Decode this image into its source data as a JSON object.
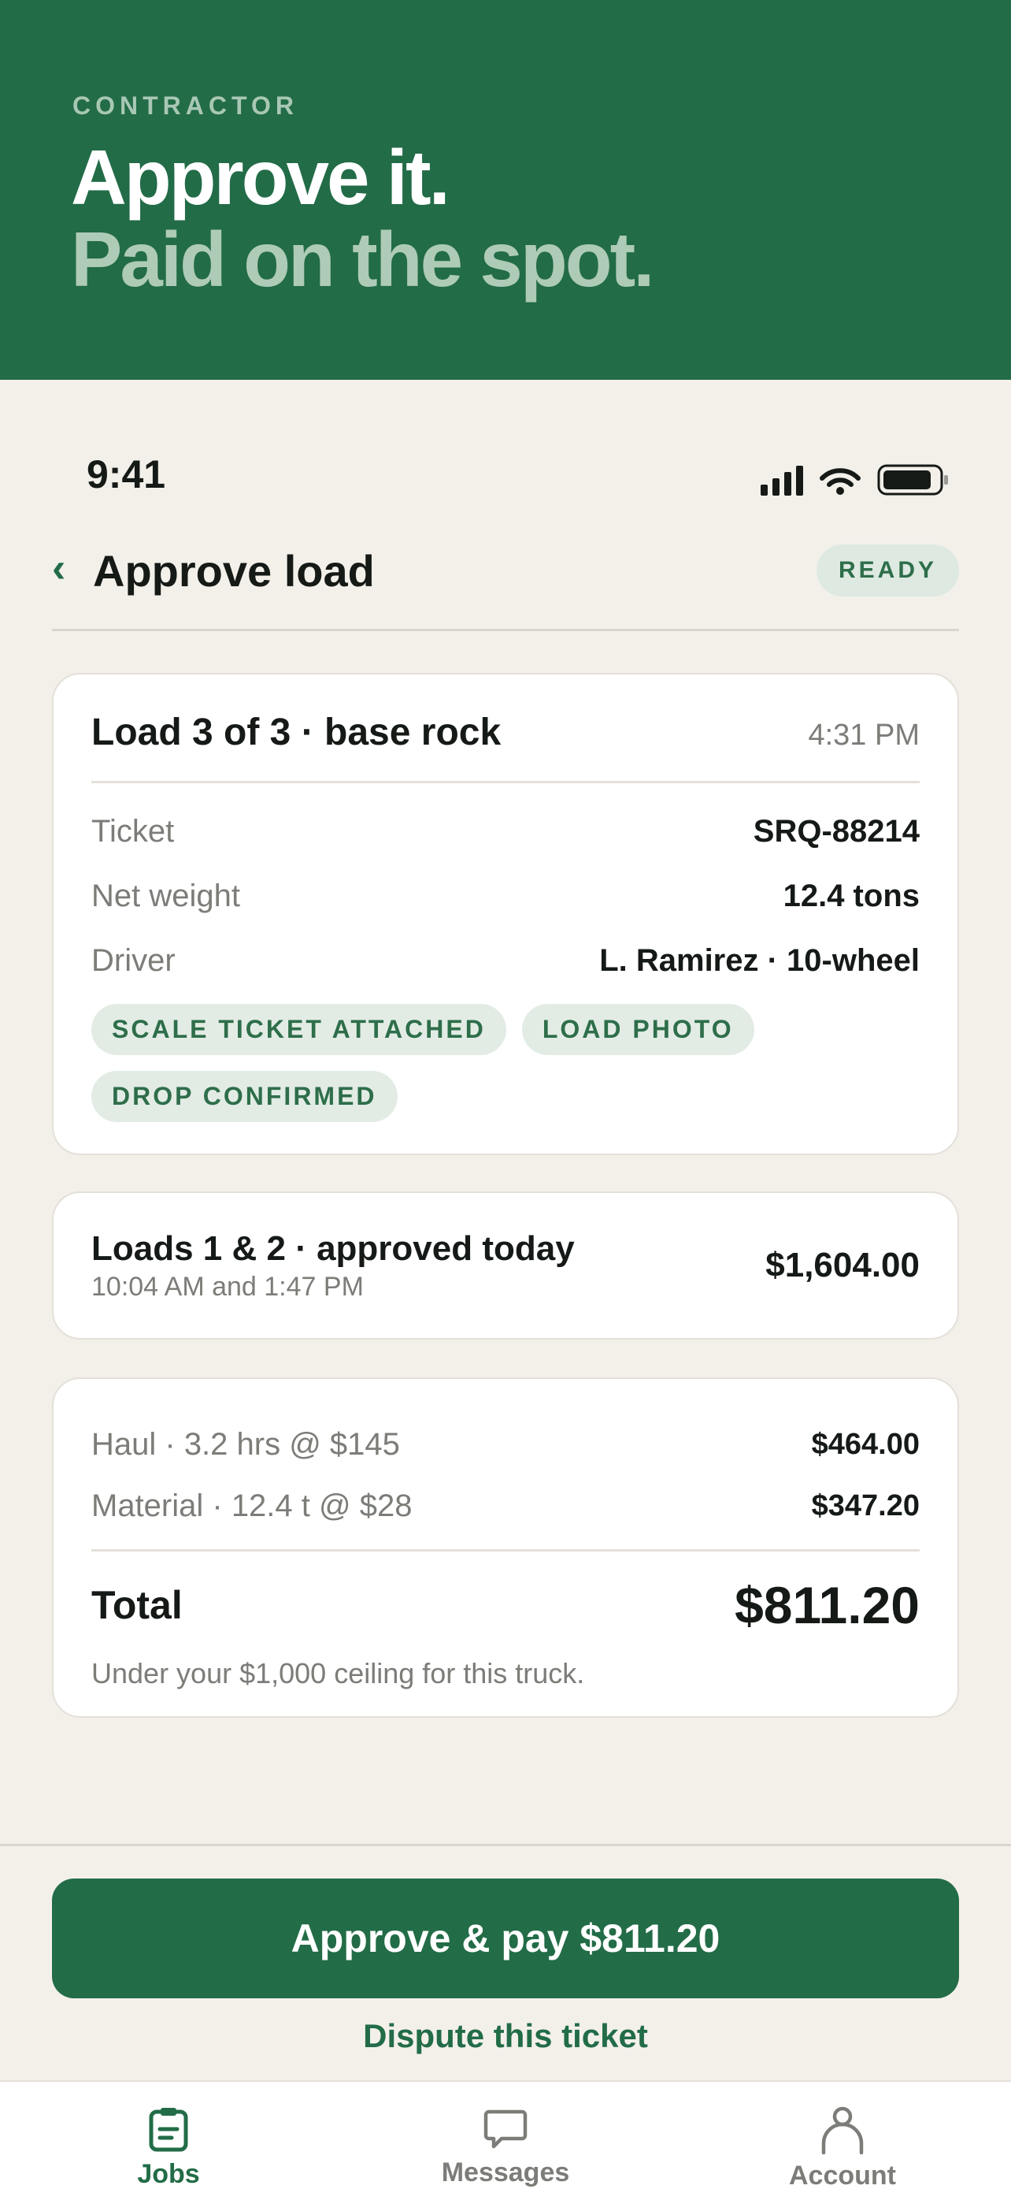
{
  "hero": {
    "kicker": "CONTRACTOR",
    "line1": "Approve it.",
    "line2": "Paid on the spot."
  },
  "status_bar": {
    "time": "9:41",
    "icons": [
      "cellular-signal-icon",
      "wifi-icon",
      "battery-icon"
    ]
  },
  "nav": {
    "back_icon": "chevron-left-icon",
    "title": "Approve load",
    "badge": "READY"
  },
  "load_card": {
    "title": "Load 3 of 3 · base rock",
    "time": "4:31 PM",
    "rows": [
      {
        "label": "Ticket",
        "value": "SRQ-88214"
      },
      {
        "label": "Net weight",
        "value": "12.4 tons"
      },
      {
        "label": "Driver",
        "value": "L. Ramirez · 10-wheel"
      }
    ],
    "chips": [
      "SCALE TICKET ATTACHED",
      "LOAD PHOTO",
      "DROP CONFIRMED"
    ]
  },
  "previous_loads": {
    "title": "Loads 1 & 2 · approved today",
    "subtitle": "10:04 AM and 1:47 PM",
    "amount": "$1,604.00"
  },
  "summary": {
    "lines": [
      {
        "label": "Haul · 3.2 hrs @ $145",
        "value": "$464.00"
      },
      {
        "label": "Material · 12.4 t @ $28",
        "value": "$347.20"
      }
    ],
    "total_label": "Total",
    "total_amount": "$811.20",
    "note": "Under your $1,000 ceiling for this truck."
  },
  "actions": {
    "approve_label": "Approve & pay $811.20",
    "dispute_label": "Dispute this ticket"
  },
  "tabbar": {
    "tabs": [
      {
        "label": "Jobs",
        "icon": "clipboard-icon",
        "active": true
      },
      {
        "label": "Messages",
        "icon": "chat-bubble-icon",
        "active": false
      },
      {
        "label": "Account",
        "icon": "person-icon",
        "active": false
      }
    ]
  },
  "colors": {
    "brand_green": "#226c47",
    "background": "#f3f0ea",
    "muted_text": "#7b7d78",
    "chip_bg": "#e2ece5"
  }
}
